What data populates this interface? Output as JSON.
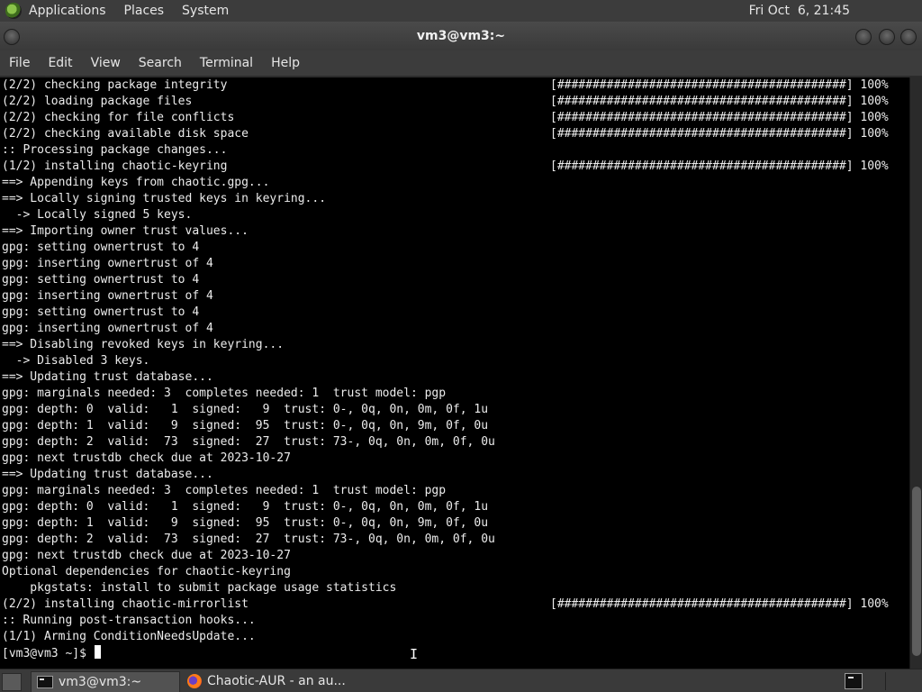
{
  "top_panel": {
    "menus": [
      "Applications",
      "Places",
      "System"
    ],
    "clock": "Fri Oct  6, 21:45"
  },
  "window": {
    "title": "vm3@vm3:~"
  },
  "menubar": {
    "items": [
      "File",
      "Edit",
      "View",
      "Search",
      "Terminal",
      "Help"
    ]
  },
  "terminal": {
    "lines": [
      {
        "text": "(2/2) checking package integrity",
        "bar": "[#########################################] 100%"
      },
      {
        "text": "(2/2) loading package files",
        "bar": "[#########################################] 100%"
      },
      {
        "text": "(2/2) checking for file conflicts",
        "bar": "[#########################################] 100%"
      },
      {
        "text": "(2/2) checking available disk space",
        "bar": "[#########################################] 100%"
      },
      {
        "text": ":: Processing package changes...",
        "bar": ""
      },
      {
        "text": "(1/2) installing chaotic-keyring",
        "bar": "[#########################################] 100%"
      },
      {
        "text": "==> Appending keys from chaotic.gpg...",
        "bar": ""
      },
      {
        "text": "==> Locally signing trusted keys in keyring...",
        "bar": ""
      },
      {
        "text": "  -> Locally signed 5 keys.",
        "bar": ""
      },
      {
        "text": "==> Importing owner trust values...",
        "bar": ""
      },
      {
        "text": "gpg: setting ownertrust to 4",
        "bar": ""
      },
      {
        "text": "gpg: inserting ownertrust of 4",
        "bar": ""
      },
      {
        "text": "gpg: setting ownertrust to 4",
        "bar": ""
      },
      {
        "text": "gpg: inserting ownertrust of 4",
        "bar": ""
      },
      {
        "text": "gpg: setting ownertrust to 4",
        "bar": ""
      },
      {
        "text": "gpg: inserting ownertrust of 4",
        "bar": ""
      },
      {
        "text": "==> Disabling revoked keys in keyring...",
        "bar": ""
      },
      {
        "text": "  -> Disabled 3 keys.",
        "bar": ""
      },
      {
        "text": "==> Updating trust database...",
        "bar": ""
      },
      {
        "text": "gpg: marginals needed: 3  completes needed: 1  trust model: pgp",
        "bar": ""
      },
      {
        "text": "gpg: depth: 0  valid:   1  signed:   9  trust: 0-, 0q, 0n, 0m, 0f, 1u",
        "bar": ""
      },
      {
        "text": "gpg: depth: 1  valid:   9  signed:  95  trust: 0-, 0q, 0n, 9m, 0f, 0u",
        "bar": ""
      },
      {
        "text": "gpg: depth: 2  valid:  73  signed:  27  trust: 73-, 0q, 0n, 0m, 0f, 0u",
        "bar": ""
      },
      {
        "text": "gpg: next trustdb check due at 2023-10-27",
        "bar": ""
      },
      {
        "text": "==> Updating trust database...",
        "bar": ""
      },
      {
        "text": "gpg: marginals needed: 3  completes needed: 1  trust model: pgp",
        "bar": ""
      },
      {
        "text": "gpg: depth: 0  valid:   1  signed:   9  trust: 0-, 0q, 0n, 0m, 0f, 1u",
        "bar": ""
      },
      {
        "text": "gpg: depth: 1  valid:   9  signed:  95  trust: 0-, 0q, 0n, 9m, 0f, 0u",
        "bar": ""
      },
      {
        "text": "gpg: depth: 2  valid:  73  signed:  27  trust: 73-, 0q, 0n, 0m, 0f, 0u",
        "bar": ""
      },
      {
        "text": "gpg: next trustdb check due at 2023-10-27",
        "bar": ""
      },
      {
        "text": "Optional dependencies for chaotic-keyring",
        "bar": ""
      },
      {
        "text": "    pkgstats: install to submit package usage statistics",
        "bar": ""
      },
      {
        "text": "(2/2) installing chaotic-mirrorlist",
        "bar": "[#########################################] 100%"
      },
      {
        "text": ":: Running post-transaction hooks...",
        "bar": ""
      },
      {
        "text": "(1/1) Arming ConditionNeedsUpdate...",
        "bar": ""
      }
    ],
    "prompt": "[vm3@vm3 ~]$ "
  },
  "taskbar": {
    "tasks": [
      {
        "label": "vm3@vm3:~",
        "icon": "terminal-icon",
        "active": true
      },
      {
        "label": "Chaotic-AUR - an au...",
        "icon": "firefox-icon",
        "active": false
      }
    ]
  }
}
